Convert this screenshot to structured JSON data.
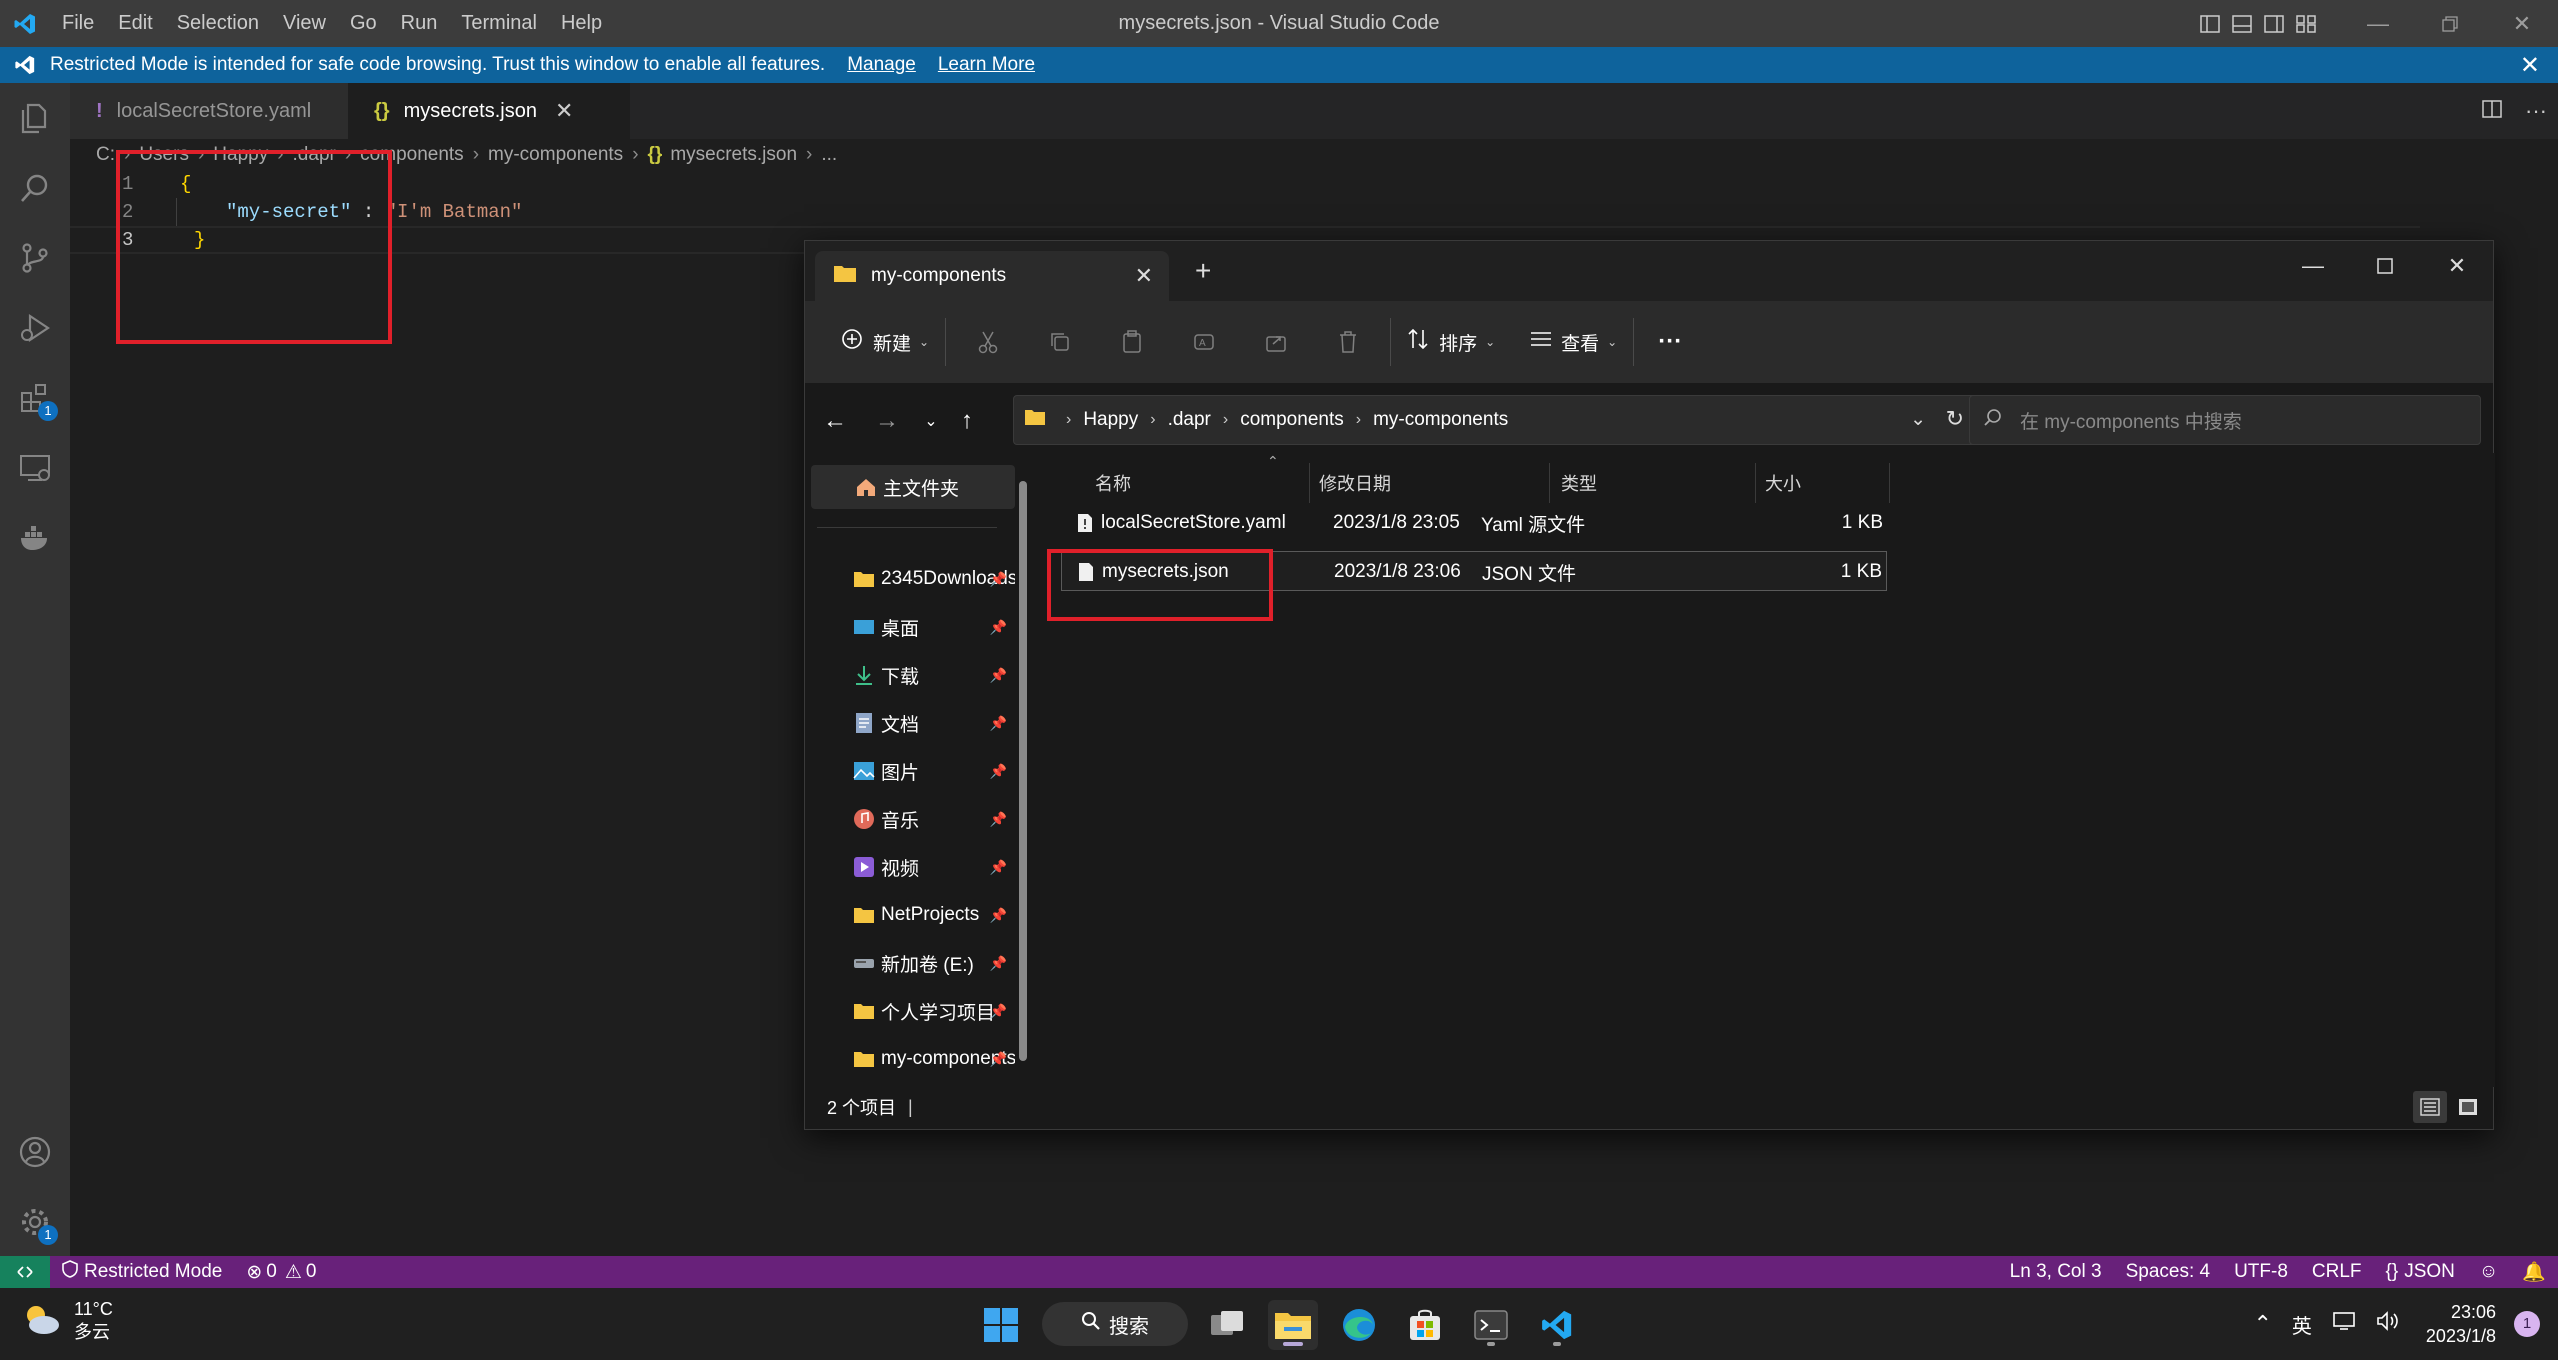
{
  "app": {
    "window_title": "mysecrets.json - Visual Studio Code",
    "menu": [
      "File",
      "Edit",
      "Selection",
      "View",
      "Go",
      "Run",
      "Terminal",
      "Help"
    ]
  },
  "banner": {
    "text": "Restricted Mode is intended for safe code browsing. Trust this window to enable all features.",
    "manage": "Manage",
    "learn_more": "Learn More"
  },
  "tabs": [
    {
      "label": "localSecretStore.yaml",
      "icon": "!"
    },
    {
      "label": "mysecrets.json",
      "icon": "{}"
    }
  ],
  "breadcrumb": {
    "parts": [
      "C:",
      "Users",
      "Happy",
      ".dapr",
      "components",
      "my-components"
    ],
    "file": "mysecrets.json",
    "file_icon": "{}",
    "tail": "..."
  },
  "editor": {
    "line_numbers": [
      "1",
      "2",
      "3"
    ],
    "line1": "{",
    "key": "\"my-secret\"",
    "colon": " : ",
    "value": "\"I'm Batman\"",
    "line3": "}"
  },
  "statusbar": {
    "mode": "Restricted Mode",
    "errors": "0",
    "warnings": "0",
    "position": "Ln 3, Col 3",
    "spaces": "Spaces: 4",
    "encoding": "UTF-8",
    "eol": "CRLF",
    "language": "JSON"
  },
  "explorer": {
    "tab_title": "my-components",
    "toolbar": {
      "new": "新建",
      "sort": "排序",
      "view": "查看",
      "more": "···"
    },
    "address": [
      "Happy",
      ".dapr",
      "components",
      "my-components"
    ],
    "search_placeholder": "在 my-components 中搜索",
    "nav": {
      "home": "主文件夹",
      "items": [
        {
          "label": "2345Downloads"
        },
        {
          "label": "桌面"
        },
        {
          "label": "下载"
        },
        {
          "label": "文档"
        },
        {
          "label": "图片"
        },
        {
          "label": "音乐"
        },
        {
          "label": "视频"
        },
        {
          "label": "NetProjects"
        },
        {
          "label": "新加卷 (E:)"
        },
        {
          "label": "个人学习项目"
        },
        {
          "label": "my-components"
        }
      ]
    },
    "columns": {
      "name": "名称",
      "modified": "修改日期",
      "type": "类型",
      "size": "大小"
    },
    "files": [
      {
        "name": "localSecretStore.yaml",
        "modified": "2023/1/8 23:05",
        "type": "Yaml 源文件",
        "size": "1 KB"
      },
      {
        "name": "mysecrets.json",
        "modified": "2023/1/8 23:06",
        "type": "JSON 文件",
        "size": "1 KB"
      }
    ],
    "status": "2 个项目"
  },
  "taskbar": {
    "temperature": "11°C",
    "weather": "多云",
    "search": "搜索",
    "ime": "英",
    "time": "23:06",
    "date": "2023/1/8",
    "notifications": "1"
  },
  "badges": {
    "extensions": "1",
    "settings": "1"
  }
}
